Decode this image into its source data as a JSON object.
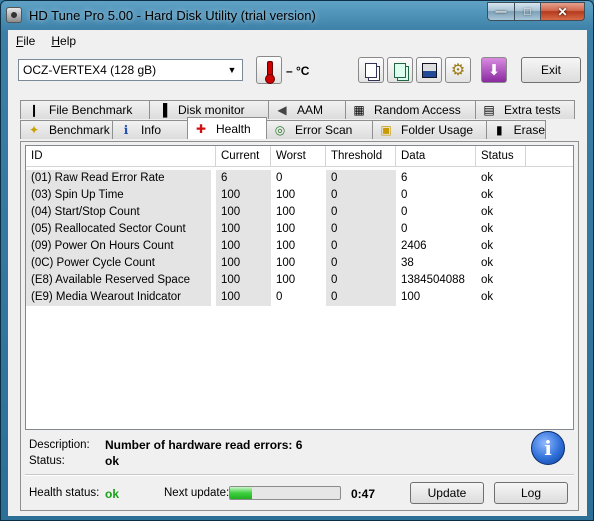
{
  "window": {
    "title": "HD Tune Pro 5.00 - Hard Disk Utility (trial version)"
  },
  "menu": [
    {
      "label": "File",
      "u": "F",
      "rest": "ile"
    },
    {
      "label": "Help",
      "u": "H",
      "rest": "elp"
    }
  ],
  "toolbar": {
    "drive": "OCZ-VERTEX4 (128 gB)",
    "temperature": "– °C",
    "exit_label": "Exit"
  },
  "tabs_top": [
    {
      "label": "File Benchmark",
      "icon": "file-benchmark-icon"
    },
    {
      "label": "Disk monitor",
      "icon": "disk-monitor-icon"
    },
    {
      "label": "AAM",
      "icon": "speaker-icon"
    },
    {
      "label": "Random Access",
      "icon": "random-access-icon"
    },
    {
      "label": "Extra tests",
      "icon": "extra-tests-icon"
    }
  ],
  "tabs_bottom": [
    {
      "label": "Benchmark",
      "icon": "lightbulb-icon"
    },
    {
      "label": "Info",
      "icon": "info-icon"
    },
    {
      "label": "Health",
      "icon": "red-cross-icon",
      "active": true
    },
    {
      "label": "Error Scan",
      "icon": "magnifier-icon"
    },
    {
      "label": "Folder Usage",
      "icon": "folder-icon"
    },
    {
      "label": "Erase",
      "icon": "trash-icon"
    }
  ],
  "grid": {
    "columns": [
      "ID",
      "Current",
      "Worst",
      "Threshold",
      "Data",
      "Status"
    ],
    "rows": [
      [
        "(01) Raw Read Error Rate",
        "6",
        "0",
        "0",
        "6",
        "ok"
      ],
      [
        "(03) Spin Up Time",
        "100",
        "100",
        "0",
        "0",
        "ok"
      ],
      [
        "(04) Start/Stop Count",
        "100",
        "100",
        "0",
        "0",
        "ok"
      ],
      [
        "(05) Reallocated Sector Count",
        "100",
        "100",
        "0",
        "0",
        "ok"
      ],
      [
        "(09) Power On Hours Count",
        "100",
        "100",
        "0",
        "2406",
        "ok"
      ],
      [
        "(0C) Power Cycle Count",
        "100",
        "100",
        "0",
        "38",
        "ok"
      ],
      [
        "(E8) Available Reserved Space",
        "100",
        "100",
        "0",
        "1384504088",
        "ok"
      ],
      [
        "(E9) Media Wearout Inidcator",
        "100",
        "0",
        "0",
        "100",
        "ok"
      ]
    ]
  },
  "details": {
    "description_label": "Description:",
    "description_value": "Number of hardware read errors: 6",
    "status_label": "Status:",
    "status_value": "ok"
  },
  "footer": {
    "health_label": "Health status:",
    "health_value": "ok",
    "next_update_label": "Next update:",
    "progress_fraction": 0.2,
    "countdown": "0:47",
    "update_label": "Update",
    "log_label": "Log"
  },
  "colors": {
    "health_ok": "#18a018",
    "progress": "#3ed03e"
  }
}
